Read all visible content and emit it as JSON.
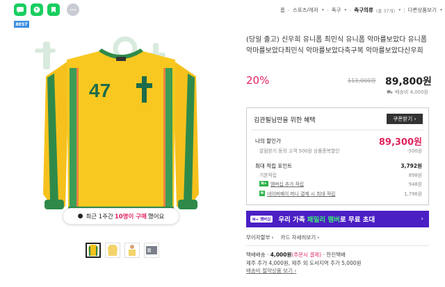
{
  "breadcrumb": {
    "items": [
      "홈",
      "스포츠/레저",
      "축구"
    ],
    "current": "축구의류",
    "current_count": "(총 37개)",
    "last": "다른상품보기"
  },
  "badge": "BEST",
  "popularity": {
    "prefix": "최근 1주간",
    "highlight": "10명이 구매",
    "suffix": "했어요"
  },
  "jersey": {
    "number": "47",
    "colors": {
      "body": "#f6c11d",
      "sleeve": "#2f8a4a",
      "text": "#1d6b4b"
    }
  },
  "product": {
    "title": "(당일 출고) 신우희 유니폼 최민식 유니폼 악마를보았다 유니폼 악마를보았다최민식 악마를보았다축구복 악마를보았다신우희",
    "discount": "20%",
    "original_price": "113,000원",
    "sale_price": "89,800원",
    "shipping": {
      "icon": "truck-icon",
      "label": "배송비 4,000원"
    }
  },
  "benefits": {
    "title": "김관필님만을 위한 혜택",
    "coupon_button": "쿠폰받기",
    "my_price_label": "나의 할인가",
    "my_price": "89,300원",
    "alarm_label": "알림받기 동의 고객 500원 상품중복할인",
    "alarm_value": "-500원",
    "points_label": "최대 적립 포인트",
    "points_value": "3,792원",
    "base_label": "기본적립",
    "base_value": "898원",
    "membership_label": "멤버십 추가 적립",
    "membership_value": "948원",
    "pay_label": "네이버페이 머니 결제 시 최대 적립",
    "pay_value": "1,796원"
  },
  "banner": {
    "tag": "N+ 멤버십",
    "prefix": "우리 가족 ",
    "emphasis": "패밀리 멤버",
    "suffix": "로 무료 초대"
  },
  "payment_options": [
    "무이자할부",
    "카드 자세히보기"
  ],
  "shipping_detail": {
    "line1_prefix": "택배배송 · ",
    "line1_price": "4,000원",
    "line1_tag": "(주문시 결제)",
    "line1_suffix": " · 한진택배",
    "line2": "제주 추가 4,000원, 제주 외 도서지역 추가 5,000원",
    "line3": "배송비 절약상품 보기"
  },
  "colors": {
    "accent": "#e0245e",
    "banner": "#4a1fc4",
    "best": "#3d8fe0"
  }
}
